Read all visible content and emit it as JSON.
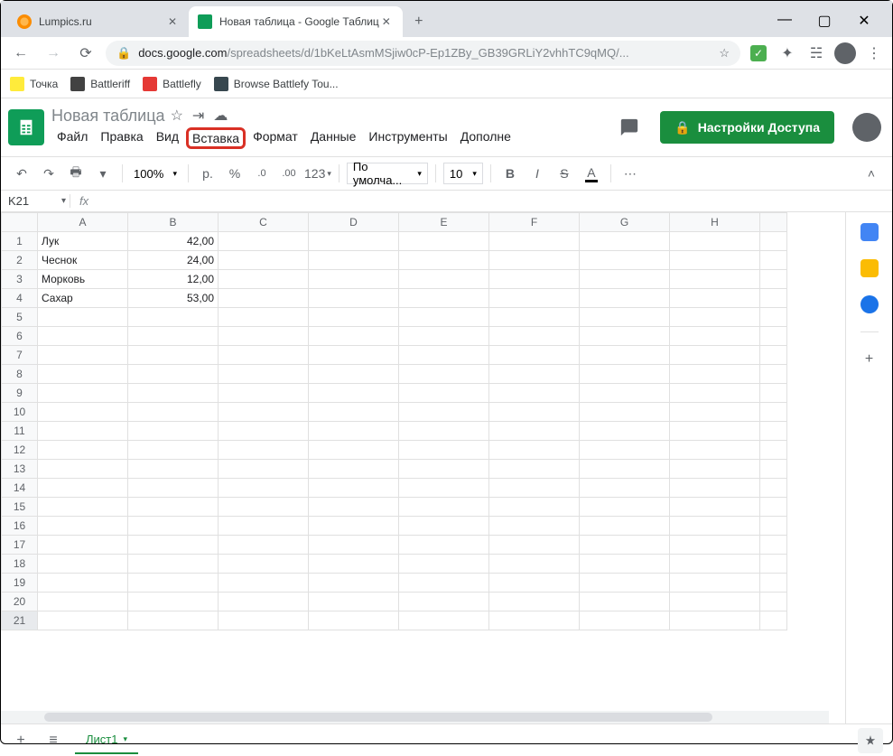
{
  "browser": {
    "tabs": [
      {
        "title": "Lumpics.ru",
        "active": false
      },
      {
        "title": "Новая таблица - Google Таблиц",
        "active": true
      }
    ],
    "url_host": "docs.google.com",
    "url_path": "/spreadsheets/d/1bKeLtAsmMSjiw0cP-Ep1ZBy_GB39GRLiY2vhhTC9qMQ/...",
    "bookmarks": [
      "Точка",
      "Battleriff",
      "Battlefly",
      "Browse Battlefy Tou..."
    ]
  },
  "doc": {
    "title": "Новая таблица",
    "menus": [
      "Файл",
      "Правка",
      "Вид",
      "Вставка",
      "Формат",
      "Данные",
      "Инструменты",
      "Дополне"
    ],
    "highlighted_menu_index": 3,
    "share_label": "Настройки Доступа"
  },
  "toolbar": {
    "zoom": "100%",
    "currency": "р.",
    "percent": "%",
    "dec_less": ".0",
    "dec_more": ".00",
    "numfmt": "123",
    "font": "По умолча...",
    "size": "10"
  },
  "namebox": "K21",
  "fx": "fx",
  "columns": [
    "A",
    "B",
    "C",
    "D",
    "E",
    "F",
    "G",
    "H"
  ],
  "rows": [
    {
      "n": 1,
      "a": "Лук",
      "b": "42,00"
    },
    {
      "n": 2,
      "a": "Чеснок",
      "b": "24,00"
    },
    {
      "n": 3,
      "a": "Морковь",
      "b": "12,00"
    },
    {
      "n": 4,
      "a": "Сахар",
      "b": "53,00"
    },
    {
      "n": 5
    },
    {
      "n": 6
    },
    {
      "n": 7
    },
    {
      "n": 8
    },
    {
      "n": 9
    },
    {
      "n": 10
    },
    {
      "n": 11
    },
    {
      "n": 12
    },
    {
      "n": 13
    },
    {
      "n": 14
    },
    {
      "n": 15
    },
    {
      "n": 16
    },
    {
      "n": 17
    },
    {
      "n": 18
    },
    {
      "n": 19
    },
    {
      "n": 20
    },
    {
      "n": 21
    }
  ],
  "selected_row": 21,
  "sheet_tab": "Лист1"
}
